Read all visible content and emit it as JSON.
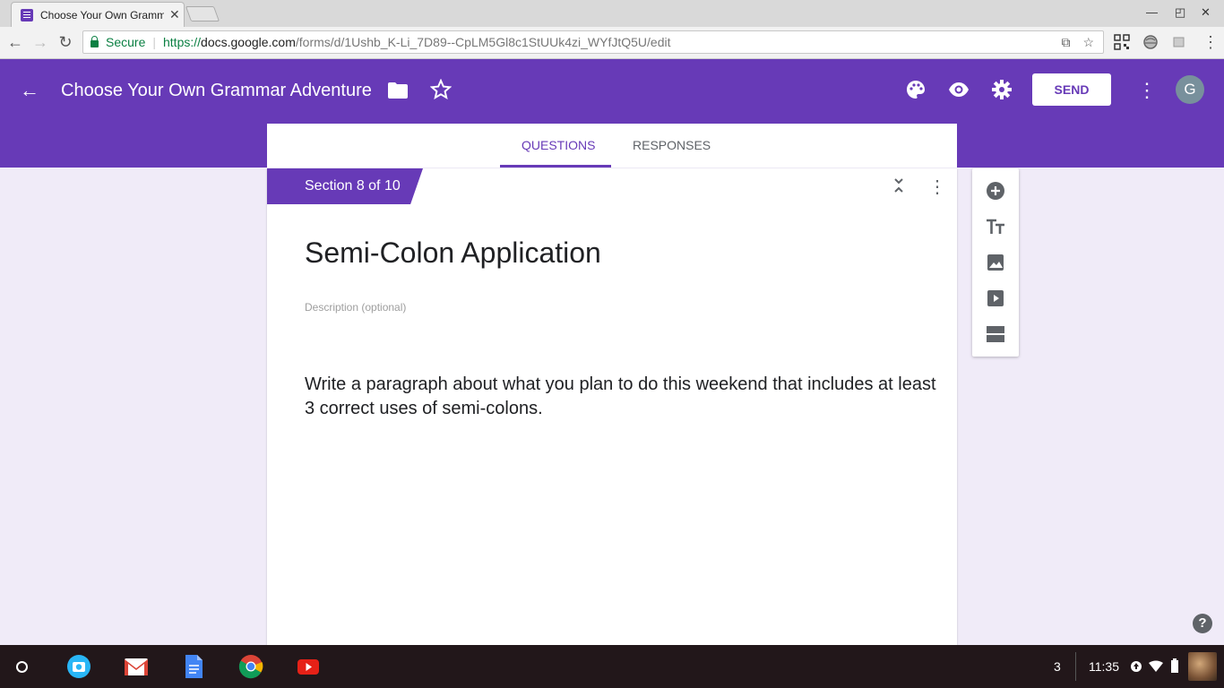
{
  "browser": {
    "tab_title": "Choose Your Own Gramm",
    "tab_close": "✕",
    "secure_label": "Secure",
    "url_scheme": "https://",
    "url_domain": "docs.google.com",
    "url_path": "/forms/d/1Ushb_K-Li_7D89--CpLM5Gl8c1StUUk4zi_WYfJtQ5U/edit"
  },
  "form_header": {
    "title": "Choose Your Own Grammar Adventure",
    "send_label": "SEND",
    "avatar_letter": "G"
  },
  "form_tabs": [
    {
      "label": "QUESTIONS",
      "active": true
    },
    {
      "label": "RESPONSES",
      "active": false
    }
  ],
  "section": {
    "tag": "Section 8 of 10",
    "title": "Semi-Colon Application",
    "description_placeholder": "Description (optional)",
    "body": "Write a paragraph about what you plan to do this weekend that includes at least 3 correct uses of semi-colons."
  },
  "side_toolbar": [
    "add-question-icon",
    "add-title-icon",
    "add-image-icon",
    "add-video-icon",
    "add-section-icon"
  ],
  "help_label": "?",
  "shelf": {
    "notification_count": "3",
    "time": "11:35",
    "apps": [
      "camera-icon",
      "gmail-icon",
      "docs-icon",
      "chrome-icon",
      "youtube-icon"
    ]
  },
  "colors": {
    "brand": "#673ab7",
    "background": "#f0ebf8"
  }
}
